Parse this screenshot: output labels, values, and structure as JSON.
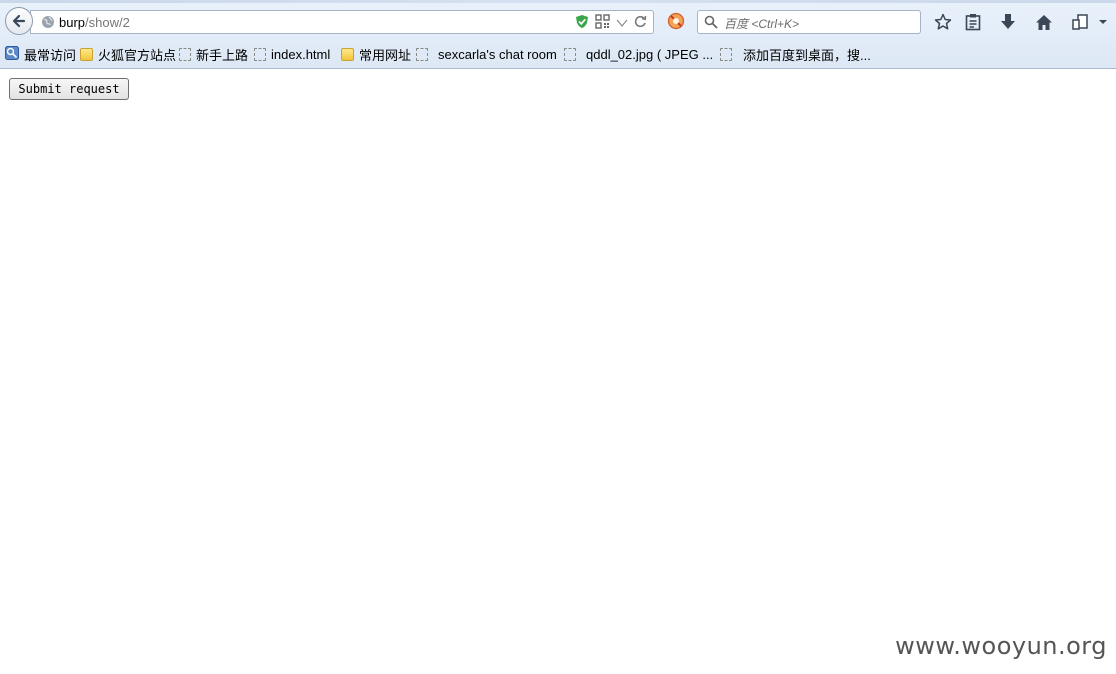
{
  "toolbar": {
    "url_host": "burp",
    "url_path": "/show/2",
    "search_placeholder": "百度 <Ctrl+K>"
  },
  "bookmarks": [
    {
      "label": "最常访问",
      "icon": "most-visited-icon"
    },
    {
      "label": "火狐官方站点",
      "icon": "folder-icon"
    },
    {
      "label": "新手上路",
      "icon": "page-icon"
    },
    {
      "label": "index.html",
      "icon": "page-icon"
    },
    {
      "label": "常用网址",
      "icon": "folder-icon"
    },
    {
      "label": "sexcarla's chat room",
      "icon": "page-icon"
    },
    {
      "label": "qddl_02.jpg ( JPEG ...",
      "icon": "page-icon"
    },
    {
      "label": "添加百度到桌面，搜...",
      "icon": "page-icon"
    }
  ],
  "page": {
    "submit_label": "Submit request",
    "watermark": "www.wooyun.org"
  }
}
